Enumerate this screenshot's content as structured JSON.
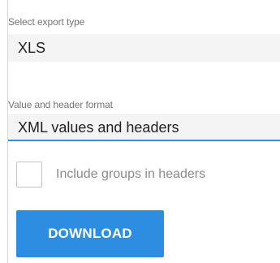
{
  "export_type": {
    "label": "Select export type",
    "value": "XLS"
  },
  "format": {
    "label": "Value and header format",
    "value": "XML values and headers"
  },
  "groups_option": {
    "label": "Include groups in headers",
    "checked": false
  },
  "download": {
    "label": "DOWNLOAD"
  },
  "colors": {
    "accent": "#2d8de0",
    "field_background": "#f4f4f4",
    "label_text": "#747474"
  }
}
